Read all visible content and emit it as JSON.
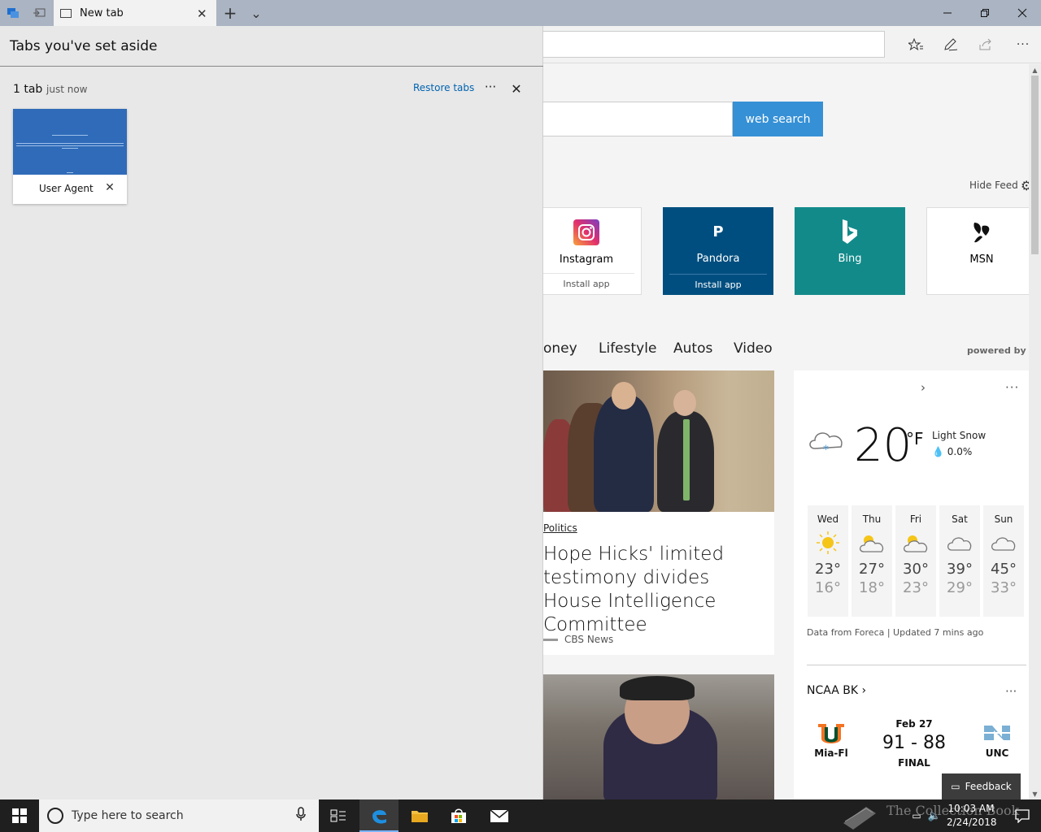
{
  "browser": {
    "tab_title": "New tab",
    "new_tab_symbol": "+",
    "tab_list_symbol": "⌄"
  },
  "new_tab_page": {
    "search_button": "web search",
    "hide_feed": "Hide Feed",
    "tiles": [
      {
        "label": "Instagram",
        "sub": "Install app",
        "icon": "instagram-icon",
        "bg": "#ffffff",
        "fg": "#111111"
      },
      {
        "label": "Pandora",
        "sub": "Install app",
        "icon": "pandora-icon",
        "glyph": "P",
        "bg": "#004e7f",
        "fg": "#ffffff"
      },
      {
        "label": "Bing",
        "icon": "bing-icon",
        "glyph": "b",
        "bg": "#138a8a",
        "fg": "#ffffff"
      },
      {
        "label": "MSN",
        "icon": "msn-icon",
        "bg": "#ffffff",
        "fg": "#111111"
      }
    ],
    "categories": [
      "oney",
      "Lifestyle",
      "Autos",
      "Video"
    ],
    "powered_by": "powered by MS",
    "article": {
      "category": "Politics",
      "headline": "Hope Hicks' limited testimony divides House Intelligence Committee",
      "source": "CBS News"
    },
    "weather": {
      "temperature": "20",
      "unit": "°F",
      "condition": "Light Snow",
      "precipitation": "0.0%",
      "forecast": [
        {
          "day": "Wed",
          "high": "23°",
          "low": "16°",
          "icon": "sunny-icon"
        },
        {
          "day": "Thu",
          "high": "27°",
          "low": "18°",
          "icon": "partly-cloudy-icon"
        },
        {
          "day": "Fri",
          "high": "30°",
          "low": "23°",
          "icon": "partly-cloudy-icon"
        },
        {
          "day": "Sat",
          "high": "39°",
          "low": "29°",
          "icon": "cloudy-icon"
        },
        {
          "day": "Sun",
          "high": "45°",
          "low": "33°",
          "icon": "cloudy-icon"
        }
      ],
      "footer": "Data from Foreca | Updated 7 mins ago"
    },
    "sports": {
      "title": "NCAA BK",
      "home_team": "Mia-Fl",
      "away_team": "UNC",
      "date": "Feb 27",
      "score": "91 - 88",
      "status": "FINAL"
    },
    "feedback": "Feedback"
  },
  "tabs_aside": {
    "title": "Tabs you've set aside",
    "count": "1 tab",
    "time": "just now",
    "restore": "Restore tabs",
    "more": "···",
    "thumbnail_label": "User Agent"
  },
  "taskbar": {
    "search_placeholder": "Type here to search",
    "time": "10:03 AM",
    "date": "2/24/2018",
    "watermark": "The Collection Book"
  },
  "colors": {
    "accent": "#3590d6",
    "link": "#0063b1",
    "taskbar": "#1f1f1f"
  }
}
